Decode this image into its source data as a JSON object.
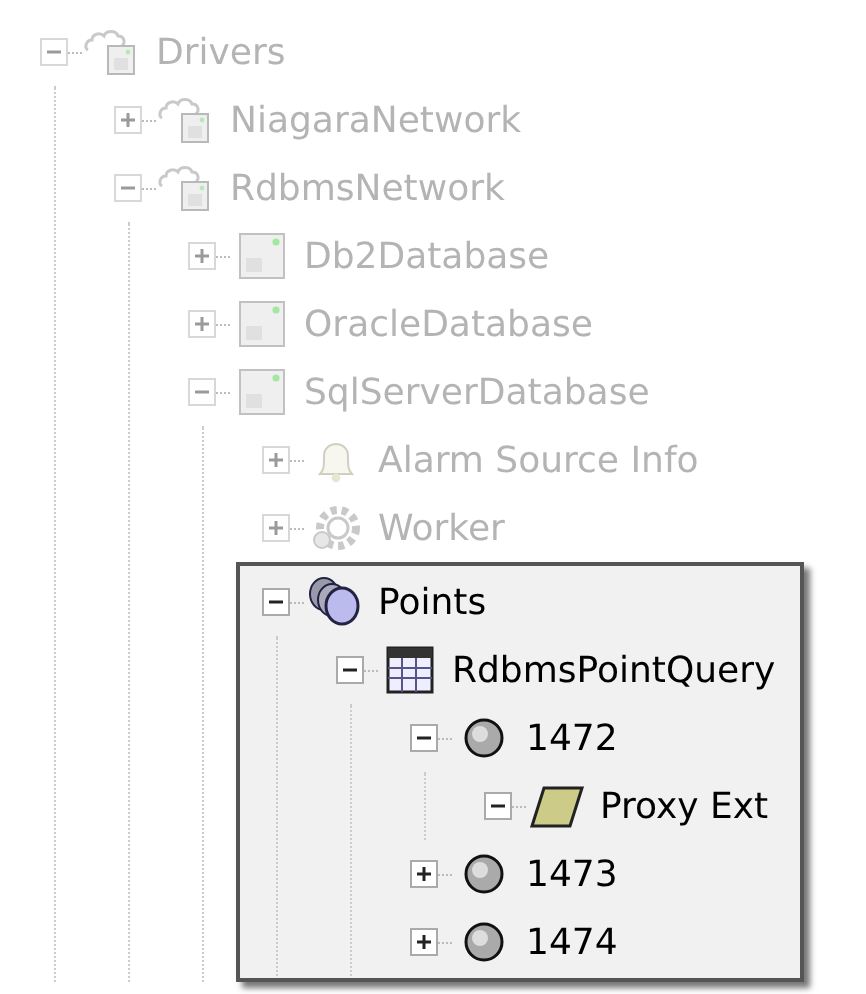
{
  "tree": [
    {
      "label": "Drivers",
      "kind": "network",
      "expanded": true,
      "dimmed": true,
      "children": [
        {
          "label": "NiagaraNetwork",
          "kind": "network",
          "expanded": false,
          "dimmed": true
        },
        {
          "label": "RdbmsNetwork",
          "kind": "network",
          "expanded": true,
          "dimmed": true,
          "children": [
            {
              "label": "Db2Database",
              "kind": "database",
              "expanded": false,
              "dimmed": true
            },
            {
              "label": "OracleDatabase",
              "kind": "database",
              "expanded": false,
              "dimmed": true
            },
            {
              "label": "SqlServerDatabase",
              "kind": "database",
              "expanded": true,
              "dimmed": true,
              "children": [
                {
                  "label": "Alarm Source Info",
                  "kind": "alarm",
                  "expanded": false,
                  "dimmed": true
                },
                {
                  "label": "Worker",
                  "kind": "gear",
                  "expanded": false,
                  "dimmed": true
                },
                {
                  "label": "Points",
                  "kind": "points",
                  "expanded": true,
                  "dimmed": false,
                  "highlighted": true,
                  "children": [
                    {
                      "label": "RdbmsPointQuery",
                      "kind": "table",
                      "expanded": true,
                      "dimmed": false,
                      "children": [
                        {
                          "label": "1472",
                          "kind": "point",
                          "expanded": true,
                          "dimmed": false,
                          "children": [
                            {
                              "label": "Proxy Ext",
                              "kind": "proxy",
                              "expanded": true,
                              "dimmed": false
                            }
                          ]
                        },
                        {
                          "label": "1473",
                          "kind": "point",
                          "expanded": false,
                          "dimmed": false
                        },
                        {
                          "label": "1474",
                          "kind": "point",
                          "expanded": false,
                          "dimmed": false
                        }
                      ]
                    }
                  ]
                }
              ]
            }
          ]
        }
      ]
    }
  ]
}
